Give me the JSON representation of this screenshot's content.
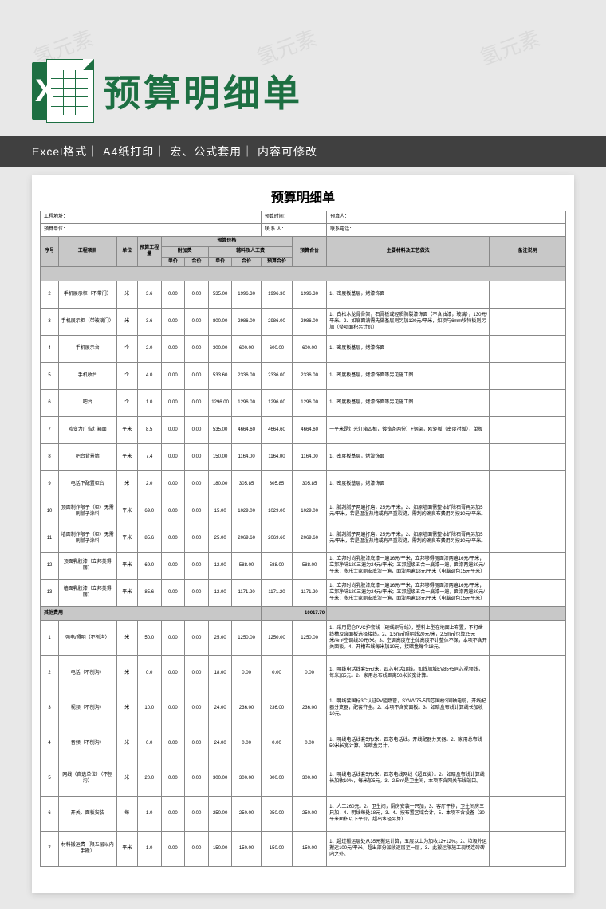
{
  "brand": {
    "icon_letter": "X",
    "title": "预算明细单",
    "subtitle": "Excel格式｜ A4纸打印｜ 宏、公式套用｜ 内容可修改"
  },
  "watermark_text": "氢元素",
  "doc": {
    "title": "预算明细单",
    "info": {
      "addr_label": "工程地址：",
      "time_label": "预算时间：",
      "person_label": "预算人：",
      "unit_label": "预算单位：",
      "contact_label": "联 系 人：",
      "phone_label": "联系电话："
    },
    "headers": {
      "seq": "序号",
      "item": "工程项目",
      "unit": "单位",
      "qty": "预算工程量",
      "price_group": "预算价格",
      "extra": "附加费",
      "matlab": "辅料及人工费",
      "up1": "单价",
      "sum1": "合价",
      "up2": "单价",
      "sum2": "合价",
      "subtotal": "预算合价",
      "desc": "主要材料及工艺做法",
      "note": "备注说明"
    },
    "section_other": "其他费用",
    "subtotal_value": "10017.70",
    "rows1": [
      {
        "n": "2",
        "item": "手机展示柜（不带门）",
        "u": "米",
        "q": "3.6",
        "a": "0.00",
        "b": "0.00",
        "c": "535.00",
        "d": "1996.30",
        "t": "1996.30",
        "desc": "1、密度板基层，烤漆饰面"
      },
      {
        "n": "3",
        "item": "手机展示柜（带玻璃门）",
        "u": "米",
        "q": "3.6",
        "a": "0.00",
        "b": "0.00",
        "c": "800.00",
        "d": "2986.00",
        "t": "2986.00",
        "desc": "1、白松木龙骨骨架，石膏板或轻质防裂漆饰面（不含油漆，玻璃），130元/平米。2、如底面满需先做基层则另加120元/平米，如项与6mm埃特板则另加（整项面积另计价）"
      },
      {
        "n": "4",
        "item": "手机展示台",
        "u": "个",
        "q": "2.0",
        "a": "0.00",
        "b": "0.00",
        "c": "300.00",
        "d": "600.00",
        "t": "600.00",
        "desc": "1、密度板基层，烤漆饰面"
      },
      {
        "n": "5",
        "item": "手机收台",
        "u": "个",
        "q": "4.0",
        "a": "0.00",
        "b": "0.00",
        "c": "533.60",
        "d": "2336.00",
        "t": "2336.00",
        "desc": "1、密度板基层，烤漆饰面等另见施工图"
      },
      {
        "n": "6",
        "item": "吧台",
        "u": "个",
        "q": "1.0",
        "a": "0.00",
        "b": "0.00",
        "c": "1296.00",
        "d": "1296.00",
        "t": "1296.00",
        "desc": "1、密度板基层，烤漆饰面等另见施工图"
      },
      {
        "n": "7",
        "item": "欧变力广告灯箱面",
        "u": "平米",
        "q": "8.5",
        "a": "0.00",
        "b": "0.00",
        "c": "535.00",
        "d": "4664.60",
        "t": "4664.60",
        "desc": "一平米是灯光灯箱四框，镀铬条两份）+钢架，欧轻板（密度衬板），单板"
      },
      {
        "n": "8",
        "item": "吧台背景墙",
        "u": "平米",
        "q": "7.4",
        "a": "0.00",
        "b": "0.00",
        "c": "150.00",
        "d": "1164.00",
        "t": "1164.00",
        "desc": "1、密度板基层，烤漆饰面"
      },
      {
        "n": "9",
        "item": "电话下配置柜台",
        "u": "米",
        "q": "2.0",
        "a": "0.00",
        "b": "0.00",
        "c": "180.00",
        "d": "305.85",
        "t": "305.85",
        "desc": "1、密度板基层，烤漆饰面"
      },
      {
        "n": "10",
        "item": "顶面制作限子（柜）无需刷腻子涂料",
        "u": "平米",
        "q": "69.0",
        "a": "0.00",
        "b": "0.00",
        "c": "15.00",
        "d": "1029.00",
        "t": "1029.00",
        "desc": "1、腻刮腻子两遍打磨，25元/平米。2、如原墙面需整体铲除石膏再另加5元/平米，若是温湿热墙或有严重裂缝，需刮的确良布费用另按10元/平米。"
      },
      {
        "n": "11",
        "item": "墙面制作限子（柜）无需刷腻子涂料",
        "u": "平米",
        "q": "85.6",
        "a": "0.00",
        "b": "0.00",
        "c": "25.00",
        "d": "2069.60",
        "t": "2069.60",
        "desc": "1、腻刮腻子两遍打磨，25元/平米。2、如原墙面需整体铲除石膏再另加5元/平米，若是温湿热墙或有严重裂缝，需刮的确良布费用另按10元/平米。"
      },
      {
        "n": "12",
        "item": "顶面乳胶漆（立邦美得丽）",
        "u": "平米",
        "q": "69.0",
        "a": "0.00",
        "b": "0.00",
        "c": "12.00",
        "d": "588.00",
        "t": "588.00",
        "desc": "1、立邦时尚乳胶漆底漆一遍16元/平米；立邦够得丽面漆两遍16元/平米；立邦净味120三遍为24元/平米；立邦超级五合一底漆一遍，面漆两遍30元/平米；多乐士家丽安底漆一遍，面漆两遍18元/平米（电脑调色15元平米）"
      },
      {
        "n": "13",
        "item": "墙面乳胶漆（立邦美得丽）",
        "u": "平米",
        "q": "85.6",
        "a": "0.00",
        "b": "0.00",
        "c": "12.00",
        "d": "1171.20",
        "t": "1171.20",
        "desc": "1、立邦时尚乳胶漆底漆一遍16元/平米；立邦够得丽面漆两遍16元/平米；立邦净味120三遍为24元/平米；立邦超级五合一底漆一遍，面漆两遍30元/平米；多乐士家丽安底漆一遍，面漆两遍18元/平米（电脑调色15元平米）"
      }
    ],
    "rows2": [
      {
        "n": "1",
        "item": "强电/照明（不刨沟）",
        "u": "米",
        "q": "50.0",
        "a": "0.00",
        "b": "0.00",
        "c": "25.00",
        "d": "1250.00",
        "t": "1250.00",
        "desc": "1、采用昆仑PVC护套线（硬线铜导线），塑料上型在地面上布置，不打凿线槽及含面板选择接线。2、1.5m㎡照明线20元/米，2.5m㎡也算25元米/4m²空调线30元/米。3、空调高度在主体高度不计整体不保，本项不含开关面板。4、开槽布线每米加10元，接暗盒每个18元。"
      },
      {
        "n": "2",
        "item": "电话（不刨沟）",
        "u": "米",
        "q": "0.0",
        "a": "0.00",
        "b": "0.00",
        "c": "18.00",
        "d": "0.00",
        "t": "0.00",
        "desc": "1、明线电话线套5元/米，四芯电话18线。如线加城EV85+5同芯视频线，每米加5元。2、家用总布线距离50米长宽计算。"
      },
      {
        "n": "3",
        "item": "视频（不刨沟）",
        "u": "米",
        "q": "10.0",
        "a": "0.00",
        "b": "0.00",
        "c": "24.00",
        "d": "236.00",
        "t": "236.00",
        "desc": "1、明线套国标3C认证PV阻燃管，SYWV75-5四芯国桥3同轴电缆，开线配器分支器，配套齐全。2、本项不含安面板。3、如暗盒布线计算线长加收10元。"
      },
      {
        "n": "4",
        "item": "音频（不刨沟）",
        "u": "米",
        "q": "0.0",
        "a": "0.00",
        "b": "0.00",
        "c": "24.00",
        "d": "0.00",
        "t": "0.00",
        "desc": "1、明线电话线套5元/米，四芯电话线。开线配器分支器。2、家用总布线50米长宽计算。如暗盒另计。"
      },
      {
        "n": "5",
        "item": "网线（自选单位）（不刨沟）",
        "u": "米",
        "q": "20.0",
        "a": "0.00",
        "b": "0.00",
        "c": "300.00",
        "d": "300.00",
        "t": "300.00",
        "desc": "1、明线电话线套5元/米，四芯电线网线（超五类）。2、如暗盒布线计算线长加收10%，每米加5元。3、2.5m²是卫生间，本项不含网关布线端口。"
      },
      {
        "n": "6",
        "item": "开关、面板安装",
        "u": "每",
        "q": "1.0",
        "a": "0.00",
        "b": "0.00",
        "c": "250.00",
        "d": "250.00",
        "t": "250.00",
        "desc": "1、人工260元。2、卫生间，厨房安装一只加，3、客厅平移，卫生间房三只加，4、明线每处18元，3、4、按布置区域合计。5、本项不含设备（30平米面积以下平价，超出水径另算）"
      },
      {
        "n": "7",
        "item": "材料搬运费（限五层以内手搬）",
        "u": "平米",
        "q": "1.0",
        "a": "0.00",
        "b": "0.00",
        "c": "150.00",
        "d": "150.00",
        "t": "150.00",
        "desc": "1、超过搬运层处从35元搬运计算，五层以上为加收12+12%。2、垃圾外运搬运100元/平米，超出部分加收逐层至一层，3、此搬运限施工现场连砖砖内之外。"
      }
    ]
  }
}
